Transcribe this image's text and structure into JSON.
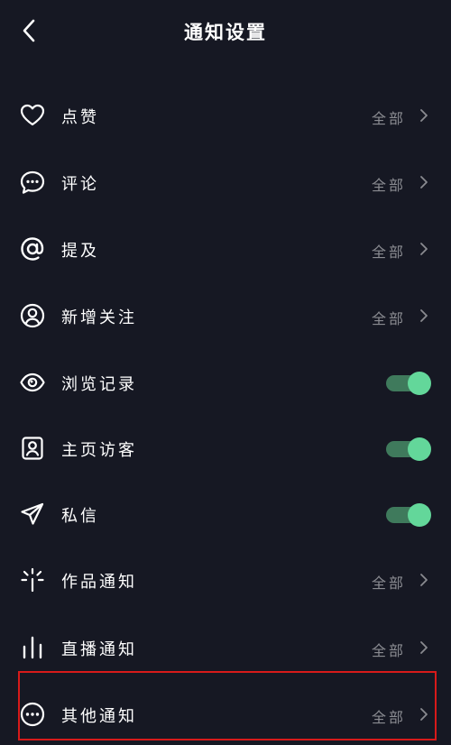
{
  "header": {
    "title": "通知设置",
    "back_icon": "chevron-left-icon"
  },
  "items": [
    {
      "id": "likes",
      "label": "点赞",
      "icon": "heart-icon",
      "type": "select",
      "value": "全部"
    },
    {
      "id": "comments",
      "label": "评论",
      "icon": "comment-icon",
      "type": "select",
      "value": "全部"
    },
    {
      "id": "mentions",
      "label": "提及",
      "icon": "at-icon",
      "type": "select",
      "value": "全部"
    },
    {
      "id": "new-follows",
      "label": "新增关注",
      "icon": "user-circle-icon",
      "type": "select",
      "value": "全部"
    },
    {
      "id": "browse-history",
      "label": "浏览记录",
      "icon": "eye-icon",
      "type": "toggle",
      "on": true
    },
    {
      "id": "profile-visitors",
      "label": "主页访客",
      "icon": "profile-card-icon",
      "type": "toggle",
      "on": true
    },
    {
      "id": "messages",
      "label": "私信",
      "icon": "send-icon",
      "type": "toggle",
      "on": true
    },
    {
      "id": "works",
      "label": "作品通知",
      "icon": "sparkle-icon",
      "type": "select",
      "value": "全部"
    },
    {
      "id": "live",
      "label": "直播通知",
      "icon": "bars-icon",
      "type": "select",
      "value": "全部"
    },
    {
      "id": "others",
      "label": "其他通知",
      "icon": "more-circle-icon",
      "type": "select",
      "value": "全部"
    }
  ],
  "colors": {
    "background": "#161823",
    "text": "#ffffff",
    "secondary_text": "#8a8b91",
    "toggle_track": "#3f7a5c",
    "toggle_knob": "#63d79a",
    "highlight_border": "#d71a1a"
  }
}
